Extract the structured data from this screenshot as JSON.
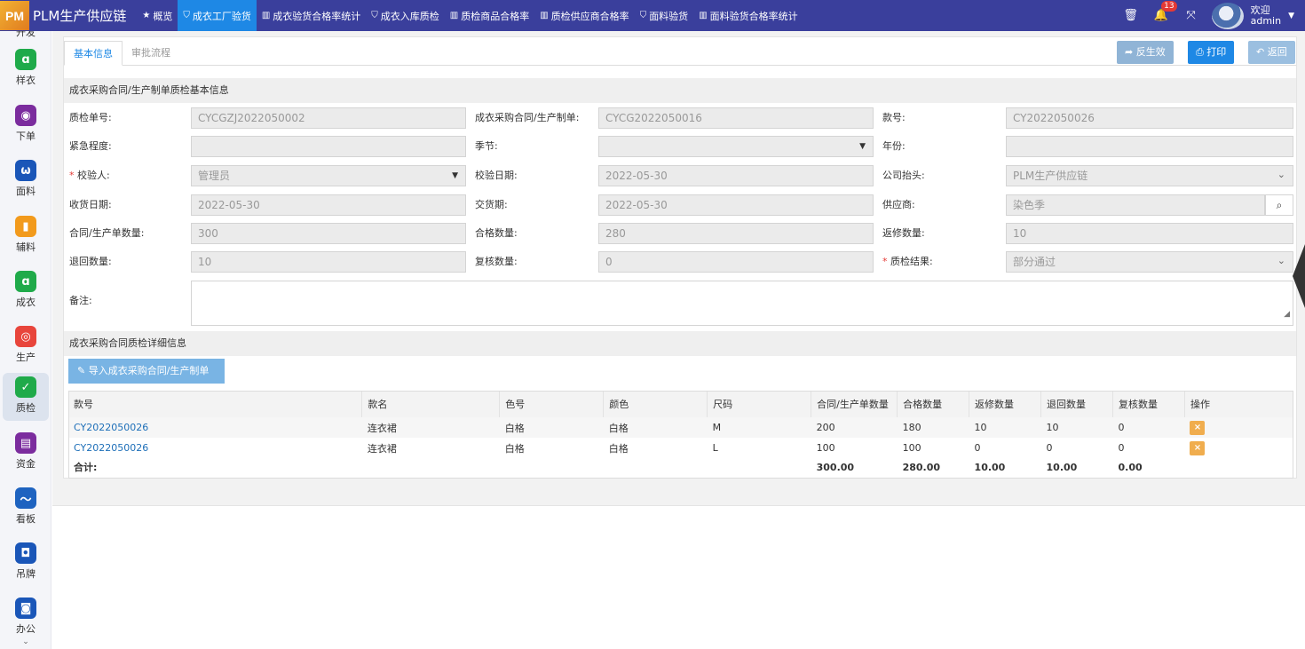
{
  "app": {
    "logo_text": "PM",
    "title": "PLM生产供应链"
  },
  "nav": [
    {
      "icon": "★",
      "label": "概览",
      "active": false
    },
    {
      "icon": "⛉",
      "label": "成衣工厂验货",
      "active": true
    },
    {
      "icon": "▥",
      "label": "成衣验货合格率统计",
      "active": false
    },
    {
      "icon": "⛉",
      "label": "成衣入库质检",
      "active": false
    },
    {
      "icon": "▥",
      "label": "质检商品合格率",
      "active": false
    },
    {
      "icon": "▥",
      "label": "质检供应商合格率",
      "active": false
    },
    {
      "icon": "⛉",
      "label": "面料验货",
      "active": false
    },
    {
      "icon": "▥",
      "label": "面料验货合格率统计",
      "active": false
    }
  ],
  "topright": {
    "notify_count": "13",
    "welcome": "欢迎",
    "user": "admin"
  },
  "sidebar": [
    {
      "label": "样衣",
      "color": "#1faa4a",
      "glyph": "ɑ"
    },
    {
      "label": "下单",
      "color": "#7b2c9e",
      "glyph": "◉"
    },
    {
      "label": "面料",
      "color": "#1a56b8",
      "glyph": "ω"
    },
    {
      "label": "辅料",
      "color": "#f29a1c",
      "glyph": "▮"
    },
    {
      "label": "成衣",
      "color": "#1faa4a",
      "glyph": "ɑ"
    },
    {
      "label": "生产",
      "color": "#e8453c",
      "glyph": "◎"
    },
    {
      "label": "质检",
      "color": "#1faa4a",
      "glyph": "✓"
    },
    {
      "label": "资金",
      "color": "#7b2c9e",
      "glyph": "▤"
    },
    {
      "label": "看板",
      "color": "#1e63c0",
      "glyph": "〜"
    },
    {
      "label": "吊牌",
      "color": "#1a56b8",
      "glyph": "◘"
    },
    {
      "label": "办公",
      "color": "#1a56b8",
      "glyph": "◙"
    }
  ],
  "tabs": {
    "basic": "基本信息",
    "approval": "审批流程"
  },
  "toolbar": {
    "reverse": "反生效",
    "print": "打印",
    "back": "返回"
  },
  "section1_title": "成衣采购合同/生产制单质检基本信息",
  "fields": {
    "qc_no_label": "质检单号:",
    "qc_no": "CYCGZJ2022050002",
    "contract_label": "成衣采购合同/生产制单:",
    "contract": "CYCG2022050016",
    "style_no_label": "款号:",
    "style_no": "CY2022050026",
    "urgency_label": "紧急程度:",
    "urgency": "",
    "season_label": "季节:",
    "season": "",
    "year_label": "年份:",
    "year": "",
    "inspector_label": "校验人:",
    "inspector": "管理员",
    "inspect_date_label": "校验日期:",
    "inspect_date": "2022-05-30",
    "company_label": "公司抬头:",
    "company": "PLM生产供应链",
    "receive_date_label": "收货日期:",
    "receive_date": "2022-05-30",
    "delivery_label": "交货期:",
    "delivery": "2022-05-30",
    "supplier_label": "供应商:",
    "supplier": "染色季",
    "contract_qty_label": "合同/生产单数量:",
    "contract_qty": "300",
    "pass_qty_label": "合格数量:",
    "pass_qty": "280",
    "repair_qty_label": "返修数量:",
    "repair_qty": "10",
    "return_qty_label": "退回数量:",
    "return_qty": "10",
    "recheck_qty_label": "复核数量:",
    "recheck_qty": "0",
    "result_label": "质检结果:",
    "result": "部分通过",
    "remark_label": "备注:",
    "remark": ""
  },
  "section2_title": "成衣采购合同质检详细信息",
  "import_button": "导入成衣采购合同/生产制单",
  "table": {
    "headers": [
      "款号",
      "款名",
      "色号",
      "颜色",
      "尺码",
      "合同/生产单数量",
      "合格数量",
      "返修数量",
      "退回数量",
      "复核数量",
      "操作"
    ],
    "rows": [
      [
        "CY2022050026",
        "连衣裙",
        "白格",
        "白格",
        "M",
        "200",
        "180",
        "10",
        "10",
        "0"
      ],
      [
        "CY2022050026",
        "连衣裙",
        "白格",
        "白格",
        "L",
        "100",
        "100",
        "0",
        "0",
        "0"
      ]
    ],
    "total_label": "合计:",
    "totals": [
      "300.00",
      "280.00",
      "10.00",
      "10.00",
      "0.00"
    ]
  }
}
